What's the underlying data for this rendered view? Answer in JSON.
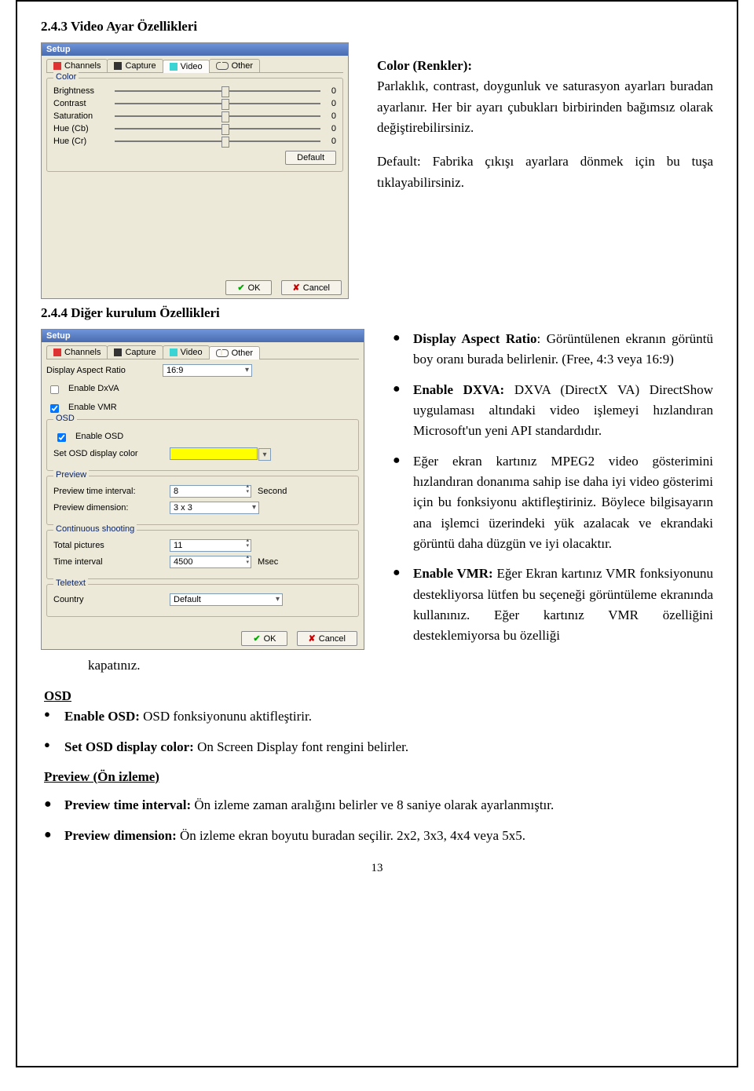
{
  "heading1": "2.4.3 Video Ayar Özellikleri",
  "heading2": "2.4.4 Diğer kurulum Özellikleri",
  "upper_text": {
    "p1_label": "Color (Renkler):",
    "p1": "Parlaklık, contrast, doygunluk ve saturasyon ayarları buradan ayarlanır. Her bir ayarı çubukları birbirinden bağımsız olarak değiştirebilirsiniz.",
    "p2": "Default: Fabrika çıkışı ayarlara dönmek için bu tuşa tıklayabilirsiniz."
  },
  "right_bullets": {
    "b1_label": "Display Aspect Ratio",
    "b1": ": Görüntülenen ekranın görüntü boy oranı burada belirlenir. (Free, 4:3 veya 16:9)",
    "b2_label": "Enable DXVA:",
    "b2": " DXVA (DirectX VA) DirectShow uygulaması altındaki video işlemeyi hızlandıran Microsoft'un yeni API standardıdır.",
    "b3": "Eğer ekran kartınız MPEG2 video gösterimini hızlandıran donanıma sahip ise daha iyi video gösterimi için bu fonksiyonu aktifleştiriniz. Böylece bilgisayarın ana işlemci üzerindeki yük azalacak ve ekrandaki görüntü daha düzgün ve iyi olacaktır.",
    "b4_label": "Enable VMR:",
    "b4": " Eğer Ekran kartınız VMR fonksiyonunu destekliyorsa lütfen bu seçeneği görüntüleme ekranında kullanınız. Eğer kartınız VMR özelliğini desteklemiyorsa bu özelliği"
  },
  "kapatiniz": "kapatınız.",
  "osd_heading": "OSD",
  "osd1_label": "Enable OSD:",
  "osd1": " OSD fonksiyonunu aktifleştirir.",
  "osd2_label": "Set OSD display color:",
  "osd2": " On Screen Display font rengini belirler.",
  "preview_heading": "Preview (Ön izleme)",
  "pv1_label": "Preview time interval:",
  "pv1": " Ön izleme zaman aralığını belirler ve 8 saniye olarak ayarlanmıştır.",
  "pv2_label": "Preview dimension:",
  "pv2": " Ön izleme ekran boyutu buradan seçilir. 2x2, 3x3, 4x4 veya 5x5.",
  "page_num": "13",
  "dlg1": {
    "title": "Setup",
    "tabs": [
      "Channels",
      "Capture",
      "Video",
      "Other"
    ],
    "group": "Color",
    "rows": [
      "Brightness",
      "Contrast",
      "Saturation",
      "Hue (Cb)",
      "Hue (Cr)"
    ],
    "zero": "0",
    "default_btn": "Default",
    "ok": "OK",
    "cancel": "Cancel"
  },
  "dlg2": {
    "title": "Setup",
    "tabs": [
      "Channels",
      "Capture",
      "Video",
      "Other"
    ],
    "aspect_label": "Display Aspect Ratio",
    "aspect_value": "16:9",
    "enable_dxva": "Enable DxVA",
    "enable_vmr": "Enable VMR",
    "osd_group": "OSD",
    "enable_osd": "Enable OSD",
    "osd_color_label": "Set OSD display color",
    "preview_group": "Preview",
    "pti_label": "Preview time interval:",
    "pti_val": "8",
    "pti_unit": "Second",
    "pd_label": "Preview dimension:",
    "pd_val": "3 x 3",
    "cs_group": "Continuous shooting",
    "tp_label": "Total pictures",
    "tp_val": "11",
    "ti_label": "Time interval",
    "ti_val": "4500",
    "ti_unit": "Msec",
    "tx_group": "Teletext",
    "country_label": "Country",
    "country_val": "Default",
    "ok": "OK",
    "cancel": "Cancel"
  }
}
